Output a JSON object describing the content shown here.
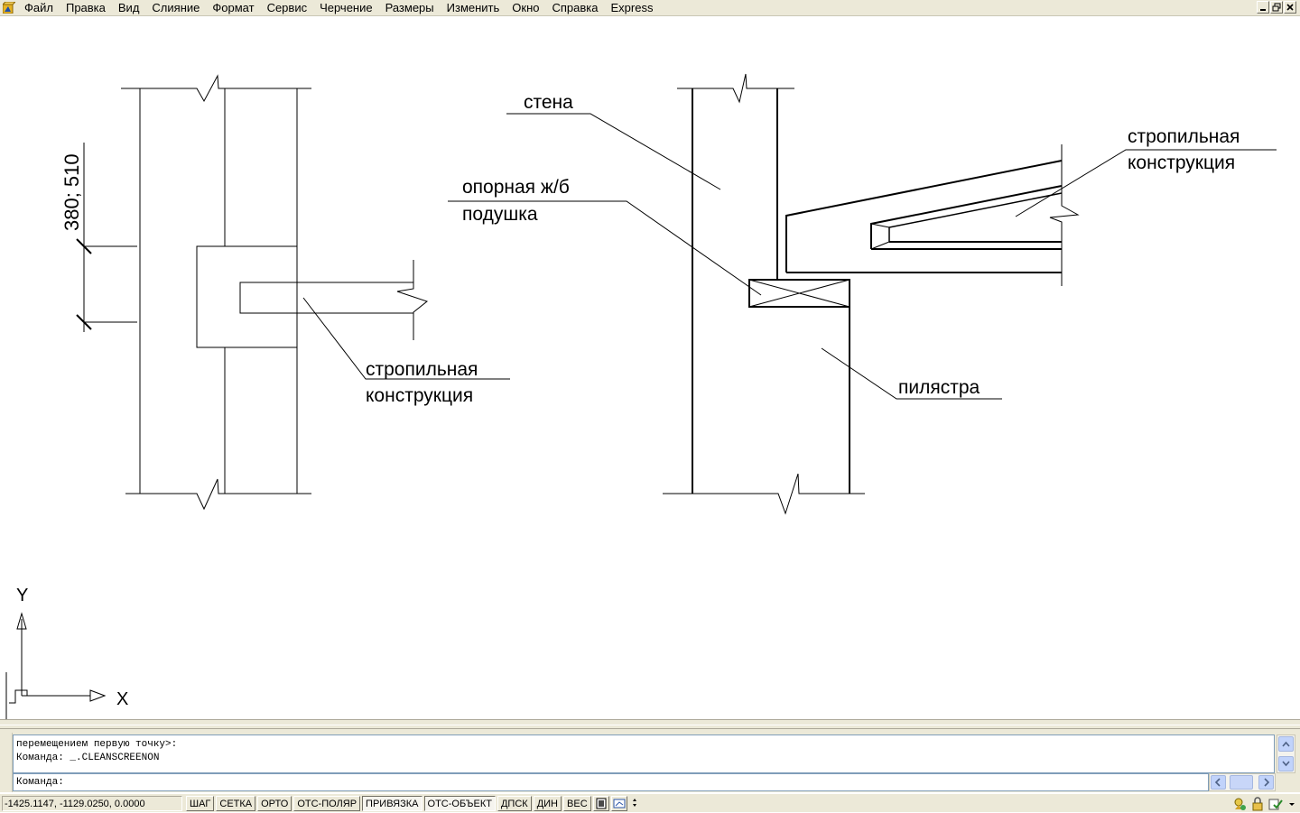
{
  "menubar": {
    "items": [
      "Файл",
      "Правка",
      "Вид",
      "Слияние",
      "Формат",
      "Сервис",
      "Черчение",
      "Размеры",
      "Изменить",
      "Окно",
      "Справка",
      "Express"
    ]
  },
  "drawing": {
    "left_detail": {
      "dimension_text": "380; 510",
      "label_line1": "стропильная",
      "label_line2": "конструкция"
    },
    "right_detail": {
      "wall_label": "стена",
      "pad_label_line1": "опорная ж/б",
      "pad_label_line2": "подушка",
      "rafter_label_line1": "стропильная",
      "rafter_label_line2": "конструкция",
      "pilaster_label": "пилястра"
    },
    "ucs": {
      "x_label": "X",
      "y_label": "Y"
    }
  },
  "command": {
    "history": [
      "перемещением первую точку>:",
      "Команда: _.CLEANSCREENON"
    ],
    "prompt": "Команда:"
  },
  "statusbar": {
    "coordinates": "-1425.1147, -1129.0250, 0.0000",
    "toggles": [
      {
        "label": "ШАГ",
        "on": false
      },
      {
        "label": "СЕТКА",
        "on": false
      },
      {
        "label": "ОРТО",
        "on": false
      },
      {
        "label": "ОТС-ПОЛЯР",
        "on": false
      },
      {
        "label": "ПРИВЯЗКА",
        "on": true
      },
      {
        "label": "ОТС-ОБЪЕКТ",
        "on": true
      },
      {
        "label": "ДПСК",
        "on": false
      },
      {
        "label": "ДИН",
        "on": false
      },
      {
        "label": "ВЕС",
        "on": false
      }
    ]
  }
}
